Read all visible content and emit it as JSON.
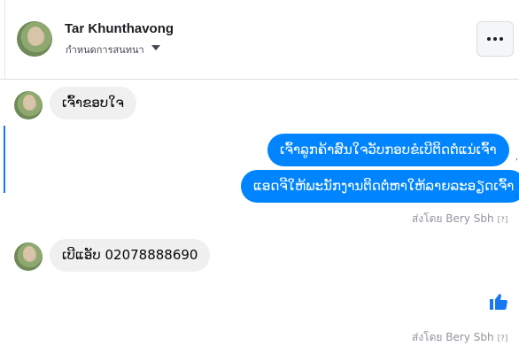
{
  "header": {
    "contact_name": "Tar Khunthavong",
    "subtitle": "กำหนดการสนทนา",
    "more_label": "More options"
  },
  "messages": [
    {
      "text": "ເຈົ້າຂອບໃຈ"
    },
    {
      "text": "ເຈົ້າລູກຄ້າສົນໃຈວັບກອບຂໍເບີຕິດຕໍ່ແນ່ເຈົ້າ"
    },
    {
      "text": "ແອດຈີໃຫ້ພະນັກງານຕິດຕໍ່ຫາໃຫ້ລາຍລະອຽດເຈົ້າ"
    },
    {
      "text": "ເບີແອັບ 02078888690"
    }
  ],
  "sent_by_1": {
    "text": "ส่งโดย Bery Sbh",
    "help": "[?]"
  },
  "sent_by_2": {
    "text": "ส่งโดย Bery Sbh",
    "help": "[?]"
  },
  "colors": {
    "outgoing": "#0084ff",
    "incoming": "#f0f0f0",
    "like": "#1877f2"
  },
  "icons": {
    "more": "dots-icon",
    "like": "thumbs-up-icon",
    "caret": "chevron-down-icon"
  }
}
